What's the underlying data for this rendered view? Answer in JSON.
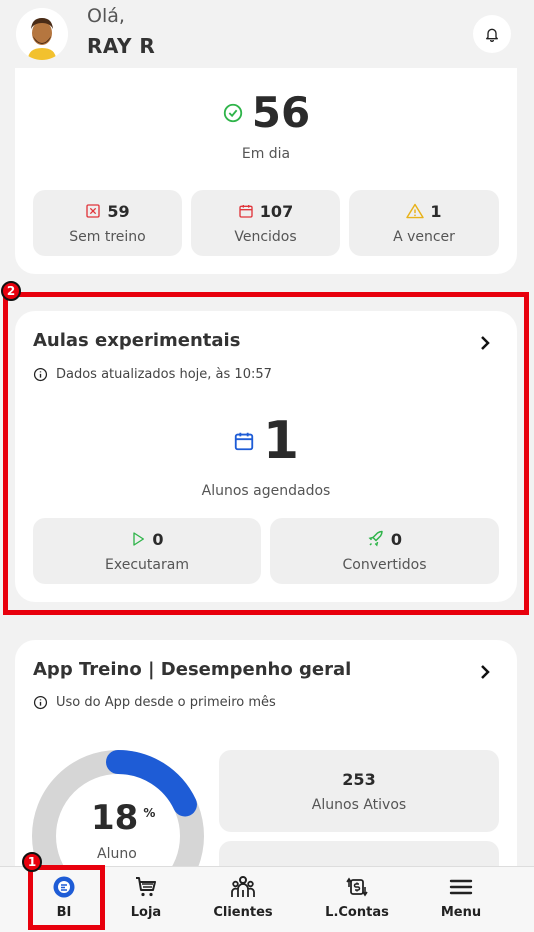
{
  "header": {
    "greeting": "Olá,",
    "user_name": "RAY R"
  },
  "treino_card": {
    "main_value": "56",
    "main_label": "Em dia",
    "tiles": [
      {
        "value": "59",
        "label": "Sem treino",
        "icon": "x-square-icon",
        "color": "#e0353b"
      },
      {
        "value": "107",
        "label": "Vencidos",
        "icon": "calendar-icon",
        "color": "#e0353b"
      },
      {
        "value": "1",
        "label": "A vencer",
        "icon": "warning-icon",
        "color": "#e8b21a"
      }
    ]
  },
  "aulas_card": {
    "title": "Aulas experimentais",
    "note": "Dados atualizados hoje, às 10:57",
    "main_value": "1",
    "main_label": "Alunos agendados",
    "tiles": [
      {
        "value": "0",
        "label": "Executaram",
        "icon": "play-icon",
        "color": "#2fb44a"
      },
      {
        "value": "0",
        "label": "Convertidos",
        "icon": "rocket-icon",
        "color": "#2fb44a"
      }
    ]
  },
  "app_card": {
    "title": "App Treino | Desempenho geral",
    "note": "Uso do App desde o primeiro mês",
    "gauge_value": "18",
    "gauge_unit": "%",
    "gauge_percent": 18,
    "gauge_label": "Aluno",
    "tile_value": "253",
    "tile_label": "Alunos Ativos"
  },
  "annotations": {
    "badge1": "1",
    "badge2": "2"
  },
  "nav": [
    {
      "label": "BI",
      "icon": "bi-icon"
    },
    {
      "label": "Loja",
      "icon": "cart-icon"
    },
    {
      "label": "Clientes",
      "icon": "people-icon"
    },
    {
      "label": "L.Contas",
      "icon": "money-transfer-icon"
    },
    {
      "label": "Menu",
      "icon": "hamburger-icon"
    }
  ],
  "colors": {
    "highlight": "#e8000d",
    "accent_blue": "#1e5cd6",
    "success": "#2fb44a"
  }
}
